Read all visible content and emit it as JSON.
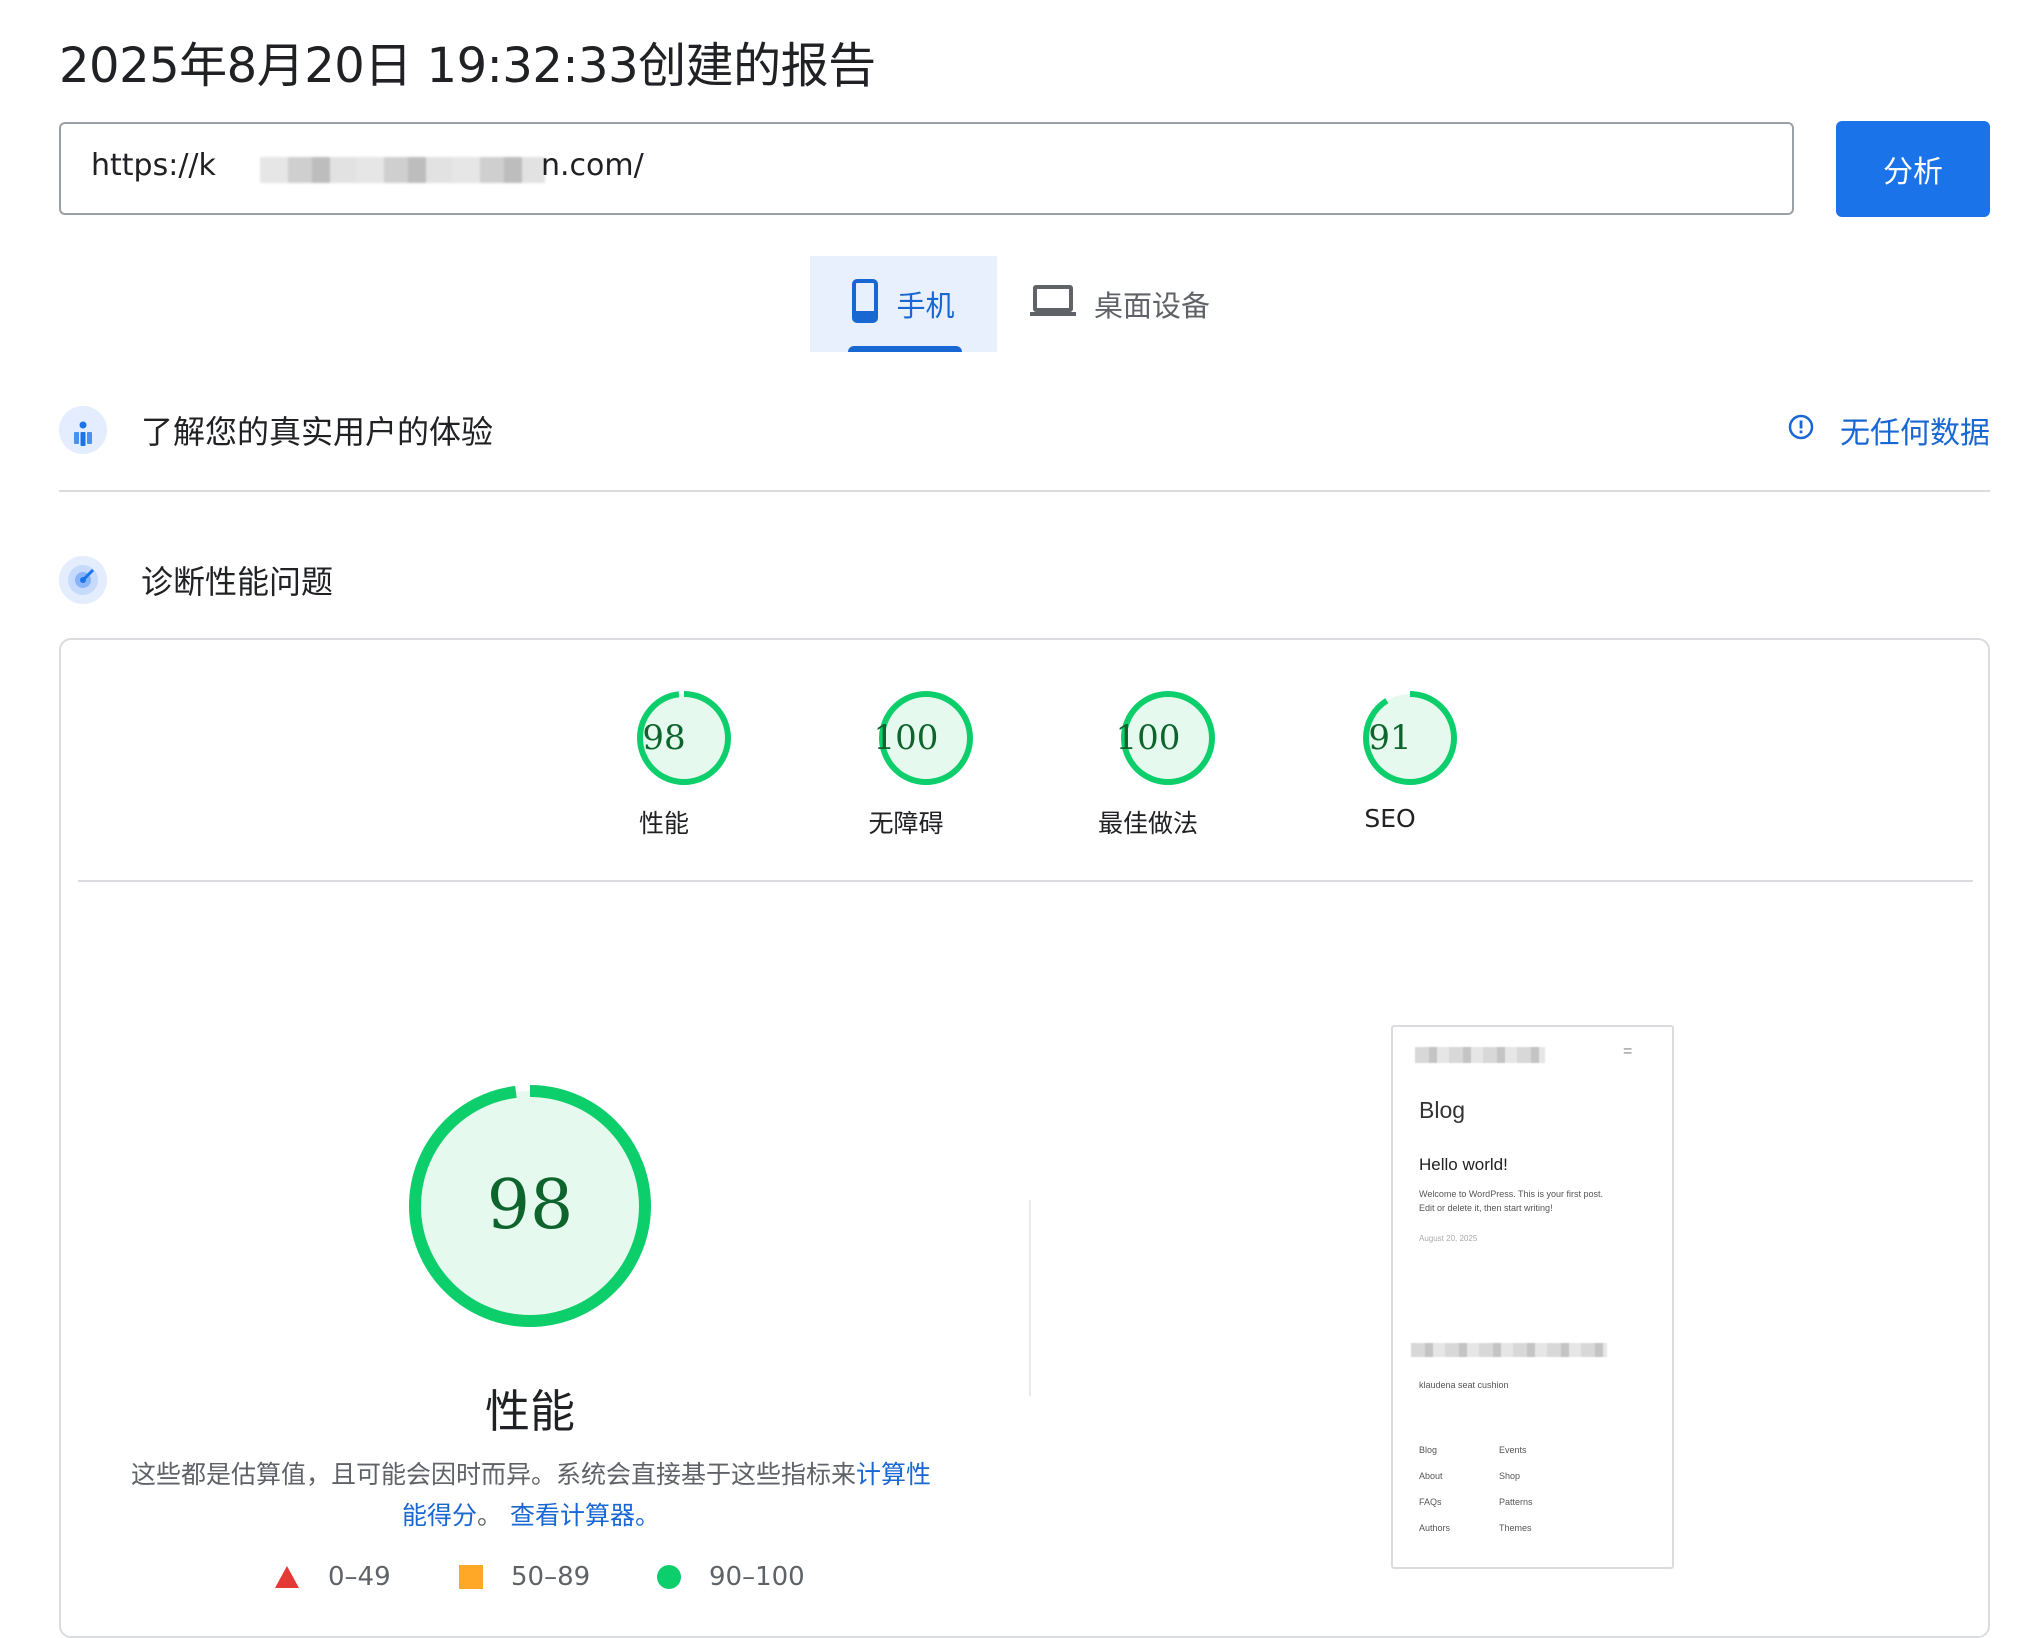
{
  "report": {
    "title": "2025年8月20日 19:32:33创建的报告"
  },
  "url_bar": {
    "value_start": "https://k",
    "value_end": "n.com/"
  },
  "actions": {
    "analyze_label": "分析"
  },
  "device_tabs": {
    "mobile_label": "手机",
    "desktop_label": "桌面设备",
    "selected": "mobile"
  },
  "field_data": {
    "title": "了解您的真实用户的体验",
    "status_text": "无任何数据"
  },
  "diagnose": {
    "title": "诊断性能问题"
  },
  "category_scores": [
    {
      "label": "性能",
      "score": "98"
    },
    {
      "label": "无障碍",
      "score": "100"
    },
    {
      "label": "最佳做法",
      "score": "100"
    },
    {
      "label": "SEO",
      "score": "91"
    }
  ],
  "performance": {
    "score": "98",
    "label": "性能",
    "disclaimer_text": "这些都是估算值，且可能会因时而异。系统会直接基于这些指标来",
    "disclaimer_link": "计算性能得分",
    "disclaimer_sep": "。",
    "calculator_link": "查看计算器。"
  },
  "legend": [
    {
      "range": "0–49",
      "shape": "triangle",
      "color": "#e53935"
    },
    {
      "range": "50–89",
      "shape": "square",
      "color": "#ffa726"
    },
    {
      "range": "90–100",
      "shape": "circle",
      "color": "#0cce6b"
    }
  ],
  "screenshot_preview": {
    "heading": "Blog",
    "post_title": "Hello world!",
    "post_body_1": "Welcome to WordPress. This is your first post.",
    "post_body_2": "Edit or delete it, then start writing!",
    "post_date": "August 20, 2025",
    "footer_text": "klaudena seat cushion",
    "nav_col1": [
      "Blog",
      "About",
      "FAQs",
      "Authors"
    ],
    "nav_col2": [
      "Events",
      "Shop",
      "Patterns",
      "Themes"
    ]
  },
  "colors": {
    "accent": "#1a73e8",
    "pass": "#0cce6b",
    "pass_fill": "#e6f9ee",
    "score_text": "#0d652d"
  }
}
